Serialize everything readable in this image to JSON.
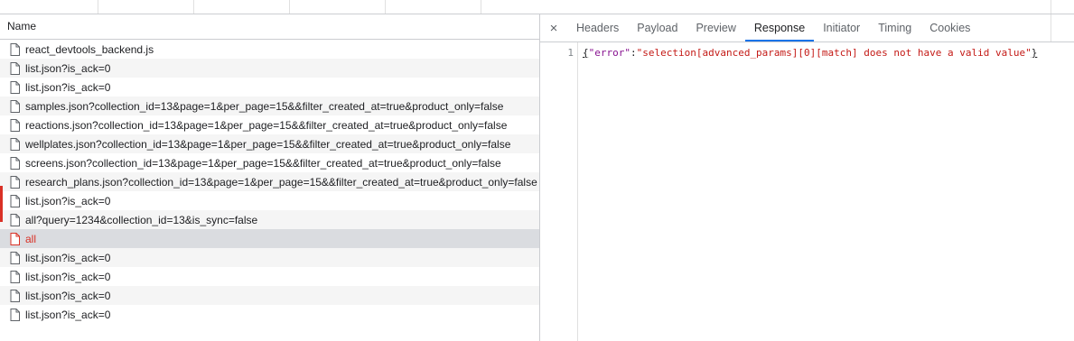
{
  "request_list": {
    "column_header": "Name",
    "rows": [
      {
        "name": "react_devtools_backend.js",
        "state": "normal"
      },
      {
        "name": "list.json?is_ack=0",
        "state": "normal"
      },
      {
        "name": "list.json?is_ack=0",
        "state": "normal"
      },
      {
        "name": "samples.json?collection_id=13&page=1&per_page=15&&filter_created_at=true&product_only=false",
        "state": "normal"
      },
      {
        "name": "reactions.json?collection_id=13&page=1&per_page=15&&filter_created_at=true&product_only=false",
        "state": "normal"
      },
      {
        "name": "wellplates.json?collection_id=13&page=1&per_page=15&&filter_created_at=true&product_only=false",
        "state": "normal"
      },
      {
        "name": "screens.json?collection_id=13&page=1&per_page=15&&filter_created_at=true&product_only=false",
        "state": "normal"
      },
      {
        "name": "research_plans.json?collection_id=13&page=1&per_page=15&&filter_created_at=true&product_only=false",
        "state": "normal"
      },
      {
        "name": "list.json?is_ack=0",
        "state": "normal"
      },
      {
        "name": "all?query=1234&collection_id=13&is_sync=false",
        "state": "normal"
      },
      {
        "name": "all",
        "state": "error-selected"
      },
      {
        "name": "list.json?is_ack=0",
        "state": "normal"
      },
      {
        "name": "list.json?is_ack=0",
        "state": "normal"
      },
      {
        "name": "list.json?is_ack=0",
        "state": "normal"
      },
      {
        "name": "list.json?is_ack=0",
        "state": "normal"
      }
    ]
  },
  "details": {
    "close_glyph": "×",
    "tabs": [
      {
        "label": "Headers",
        "active": false
      },
      {
        "label": "Payload",
        "active": false
      },
      {
        "label": "Preview",
        "active": false
      },
      {
        "label": "Response",
        "active": true
      },
      {
        "label": "Initiator",
        "active": false
      },
      {
        "label": "Timing",
        "active": false
      },
      {
        "label": "Cookies",
        "active": false
      }
    ],
    "response": {
      "line_number": "1",
      "open_brace": "{",
      "key": "\"error\"",
      "colon": ":",
      "value": "\"selection[advanced_params][0][match] does not have a valid value\"",
      "close_brace": "}"
    }
  },
  "colors": {
    "accent": "#1a73e8",
    "error": "#d93025",
    "selected_row": "#dadce0"
  }
}
